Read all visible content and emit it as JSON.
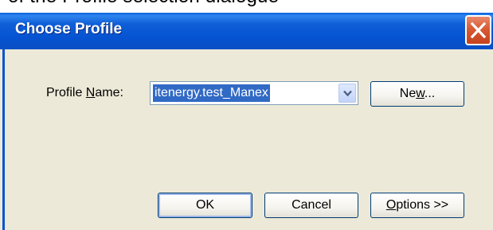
{
  "background": {
    "partial_text": "of the Profile selection dialogue"
  },
  "dialog": {
    "title": "Choose Profile",
    "close_glyph": "close-icon",
    "profile_label": {
      "before": "Profile ",
      "accel": "N",
      "after": "ame:"
    },
    "profile_value": "itenergy.test_Manex",
    "buttons": {
      "new": {
        "before": "Ne",
        "accel": "w",
        "after": "..."
      },
      "ok": "OK",
      "cancel": "Cancel",
      "options": {
        "before": "",
        "accel": "O",
        "after": "ptions >>"
      }
    }
  },
  "colors": {
    "title_bar": "#0553d0",
    "close_button": "#d85a33",
    "dialog_face": "#ece9d8",
    "selection": "#316ac5"
  }
}
